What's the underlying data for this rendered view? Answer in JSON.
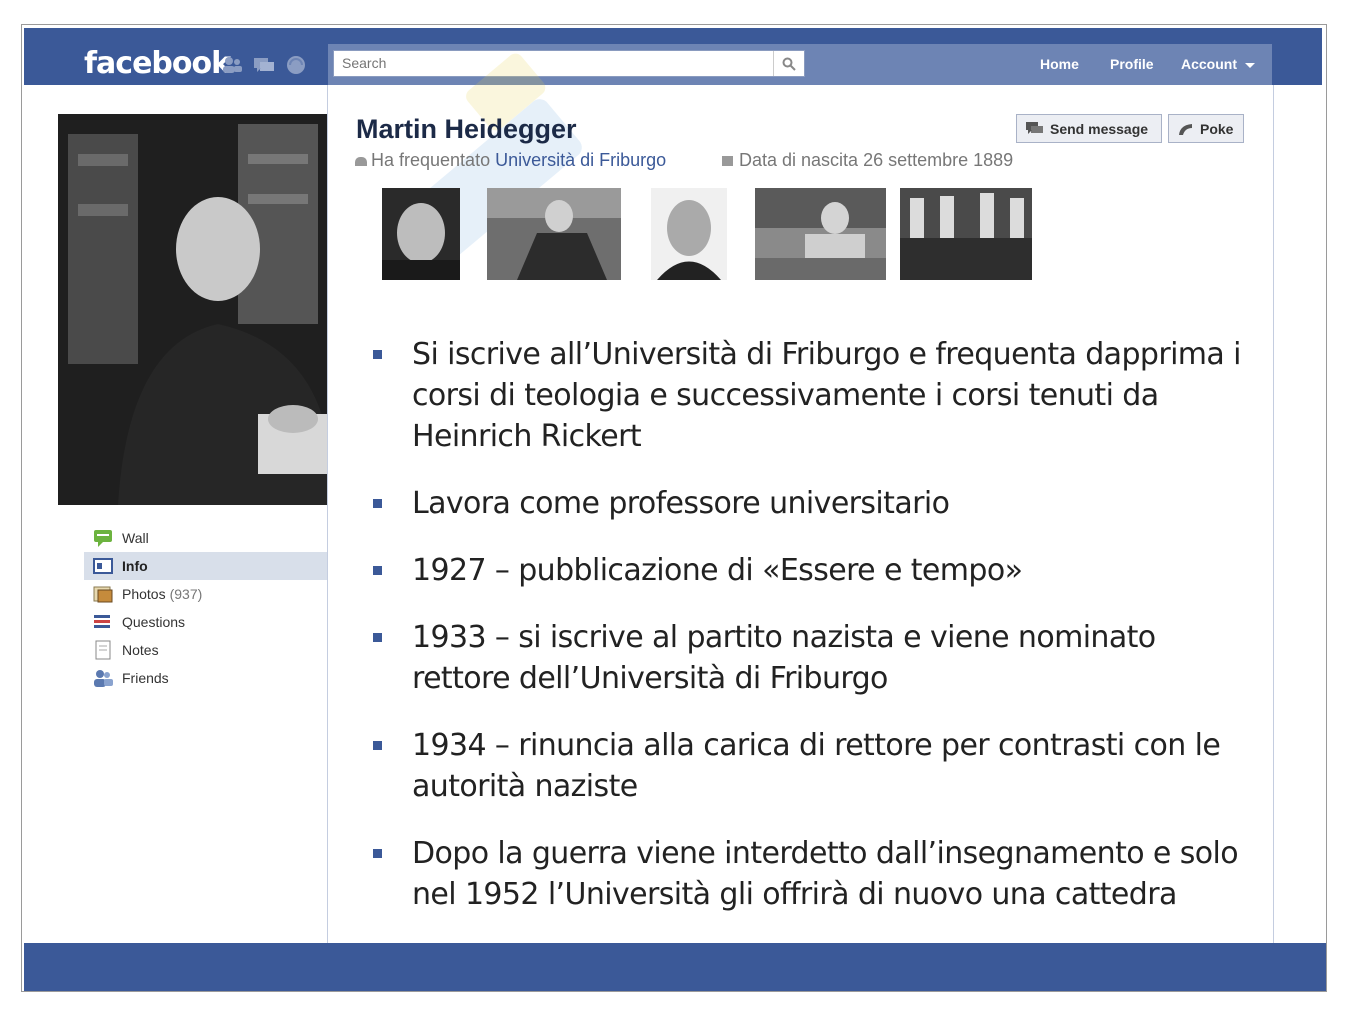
{
  "header": {
    "logo": "facebook",
    "search_placeholder": "Search",
    "nav": [
      "Home",
      "Profile",
      "Account"
    ]
  },
  "profile": {
    "name": "Martin Heidegger",
    "studied_prefix": "Ha frequentato ",
    "studied_school": "Università di Friburgo",
    "birth": "Data di nascita 26 settembre 1889"
  },
  "actions": {
    "send_message": "Send message",
    "poke": "Poke"
  },
  "sidebar": {
    "items": [
      {
        "label": "Wall",
        "count": "",
        "icon": "wall-icon"
      },
      {
        "label": "Info",
        "count": "",
        "icon": "info-icon"
      },
      {
        "label": "Photos",
        "count": "(937)",
        "icon": "photos-icon"
      },
      {
        "label": "Questions",
        "count": "",
        "icon": "questions-icon"
      },
      {
        "label": "Notes",
        "count": "",
        "icon": "notes-icon"
      },
      {
        "label": "Friends",
        "count": "",
        "icon": "friends-icon"
      }
    ]
  },
  "bullets": [
    "Si iscrive all’Università di Friburgo e frequenta dapprima i corsi di teologia e successivamente i corsi tenuti da Heinrich Rickert",
    "Lavora come professore universitario",
    "1927 – pubblicazione di «Essere e tempo»",
    "1933 – si iscrive al partito nazista e viene nominato rettore dell’Università di Friburgo",
    "1934 – rinuncia alla carica di rettore per contrasti con le autorità naziste",
    "Dopo la guerra viene interdetto dall’insegnamento e solo nel 1952 l’Università gli offrirà di nuovo una cattedra"
  ],
  "colors": {
    "brand": "#3b5998",
    "nav_bar": "#6d84b4",
    "active_item": "#d8dfea"
  }
}
